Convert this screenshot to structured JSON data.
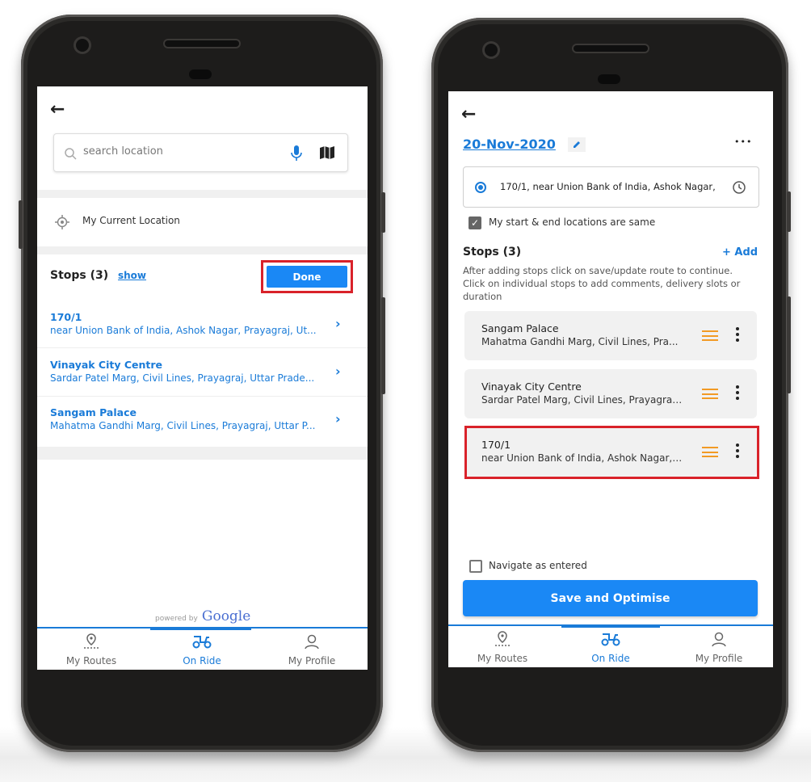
{
  "screen1": {
    "search": {
      "placeholder": "search location"
    },
    "current_location_label": "My Current Location",
    "stops_label": "Stops (3)",
    "show_link": "show",
    "done_button": "Done",
    "stops": [
      {
        "title": "170/1",
        "address": "near Union Bank of India, Ashok Nagar, Prayagraj, Ut..."
      },
      {
        "title": "Vinayak City Centre",
        "address": "Sardar Patel Marg, Civil Lines, Prayagraj, Uttar Prade..."
      },
      {
        "title": "Sangam Palace",
        "address": "Mahatma Gandhi Marg, Civil Lines, Prayagraj, Uttar P..."
      }
    ],
    "powered_by": "powered by",
    "google": "Google"
  },
  "screen2": {
    "date": "20-Nov-2020",
    "more_label": "•••",
    "start_address": "170/1, near Union Bank of India, Ashok Nagar,",
    "same_locations_label": "My start & end locations are same",
    "stops_label": "Stops (3)",
    "add_label": "+ Add",
    "help_text": "After adding stops click on save/update route to continue. Click on individual stops to add comments, delivery slots or duration",
    "stops": [
      {
        "title": "Sangam Palace",
        "address": "Mahatma Gandhi Marg, Civil Lines, Pra..."
      },
      {
        "title": "Vinayak City Centre",
        "address": "Sardar Patel Marg, Civil Lines, Prayagraj..."
      },
      {
        "title": "170/1",
        "address": "near Union Bank of India, Ashok Nagar, ..."
      }
    ],
    "navigate_label": "Navigate as entered",
    "save_button": "Save and Optimise"
  },
  "nav": {
    "items": [
      {
        "label": "My Routes",
        "icon": "routes-pin-icon"
      },
      {
        "label": "On Ride",
        "icon": "scooter-icon"
      },
      {
        "label": "My Profile",
        "icon": "profile-icon"
      }
    ],
    "active": "On Ride"
  },
  "colors": {
    "accent": "#1a7bd8",
    "button": "#1a88f5",
    "highlight": "#d9222a",
    "drag_handle": "#f29a24"
  }
}
